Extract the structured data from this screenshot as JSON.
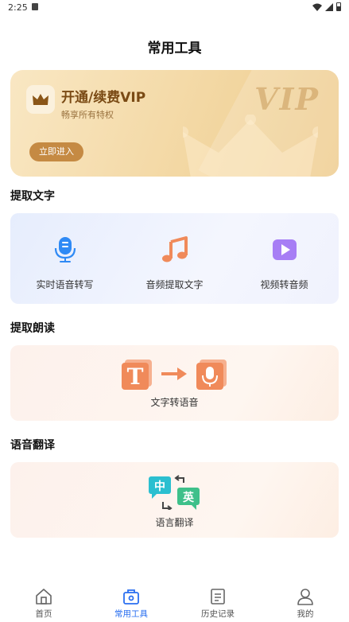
{
  "status": {
    "time": "2:25"
  },
  "page_title": "常用工具",
  "vip": {
    "title": "开通/续费VIP",
    "subtitle": "畅享所有特权",
    "watermark": "VIP",
    "enter_label": "立即进入"
  },
  "sections": {
    "extract_text": {
      "title": "提取文字",
      "tools": [
        {
          "label": "实时语音转写",
          "icon": "microphone-icon"
        },
        {
          "label": "音频提取文字",
          "icon": "music-note-icon"
        },
        {
          "label": "视频转音频",
          "icon": "video-play-icon"
        }
      ]
    },
    "read_aloud": {
      "title": "提取朗读",
      "tool": {
        "label": "文字转语音",
        "icon": "text-to-speech-icon",
        "text_glyph": "T"
      }
    },
    "translate": {
      "title": "语音翻译",
      "tool": {
        "label": "语言翻译",
        "icon": "translate-icon",
        "lang_a": "中",
        "lang_b": "英"
      }
    }
  },
  "tabbar": {
    "tabs": [
      {
        "label": "首页",
        "icon": "home-icon",
        "active": false
      },
      {
        "label": "常用工具",
        "icon": "toolbox-icon",
        "active": true
      },
      {
        "label": "历史记录",
        "icon": "document-icon",
        "active": false
      },
      {
        "label": "我的",
        "icon": "user-icon",
        "active": false
      }
    ]
  },
  "colors": {
    "accent": "#2a6ff0",
    "vip_gold": "#c58a43",
    "orange": "#f08a5a",
    "purple": "#a77ef5",
    "mic_blue": "#2f8af5",
    "translate_teal": "#2bbfd0",
    "translate_green": "#3ec08a"
  }
}
